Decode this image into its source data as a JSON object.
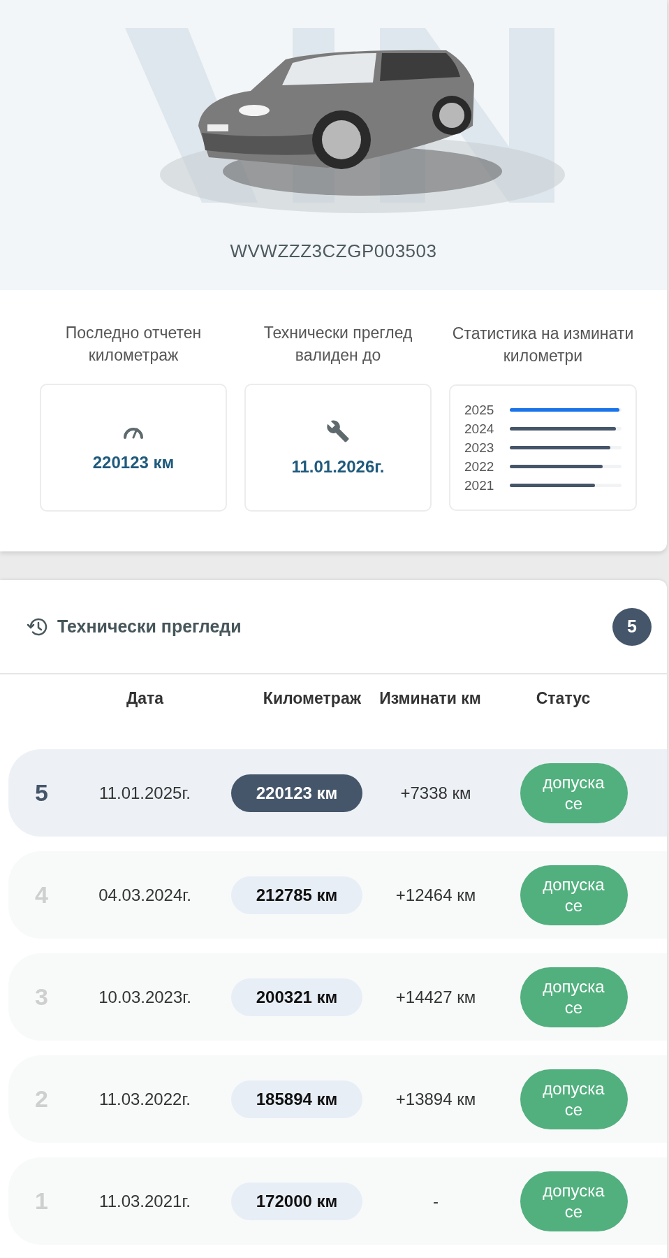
{
  "vehicle": {
    "vin": "WVWZZZ3CZGP003503"
  },
  "stats": [
    {
      "kind": "mileage",
      "label": "Последно отчетен километраж",
      "value": "220123 км"
    },
    {
      "kind": "inspection",
      "label": "Технически преглед валиден до",
      "value": "11.01.2026г."
    },
    {
      "kind": "chart",
      "label": "Статистика на изминати километри",
      "years": [
        {
          "year": "2025",
          "level": 0.98,
          "selected": true
        },
        {
          "year": "2024",
          "level": 0.95,
          "selected": false
        },
        {
          "year": "2023",
          "level": 0.9,
          "selected": false
        },
        {
          "year": "2022",
          "level": 0.83,
          "selected": false
        },
        {
          "year": "2021",
          "level": 0.76,
          "selected": false
        }
      ]
    }
  ],
  "inspections": {
    "title": "Технически прегледи",
    "count": "5",
    "columns": [
      "Дата",
      "Километраж",
      "Изминати км",
      "Статус"
    ],
    "rows": [
      {
        "number": "5",
        "date": "11.01.2025г.",
        "mileage": "220123 км",
        "delta": "+7338 км",
        "status": "допуска се",
        "selected": true
      },
      {
        "number": "4",
        "date": "04.03.2024г.",
        "mileage": "212785 км",
        "delta": "+12464 км",
        "status": "допуска се",
        "selected": false
      },
      {
        "number": "3",
        "date": "10.03.2023г.",
        "mileage": "200321 км",
        "delta": "+14427 км",
        "status": "допуска се",
        "selected": false
      },
      {
        "number": "2",
        "date": "11.03.2022г.",
        "mileage": "185894 км",
        "delta": "+13894 км",
        "status": "допуска се",
        "selected": false
      },
      {
        "number": "1",
        "date": "11.03.2021г.",
        "mileage": "172000 км",
        "delta": "-",
        "status": "допуска се",
        "selected": false
      }
    ]
  }
}
